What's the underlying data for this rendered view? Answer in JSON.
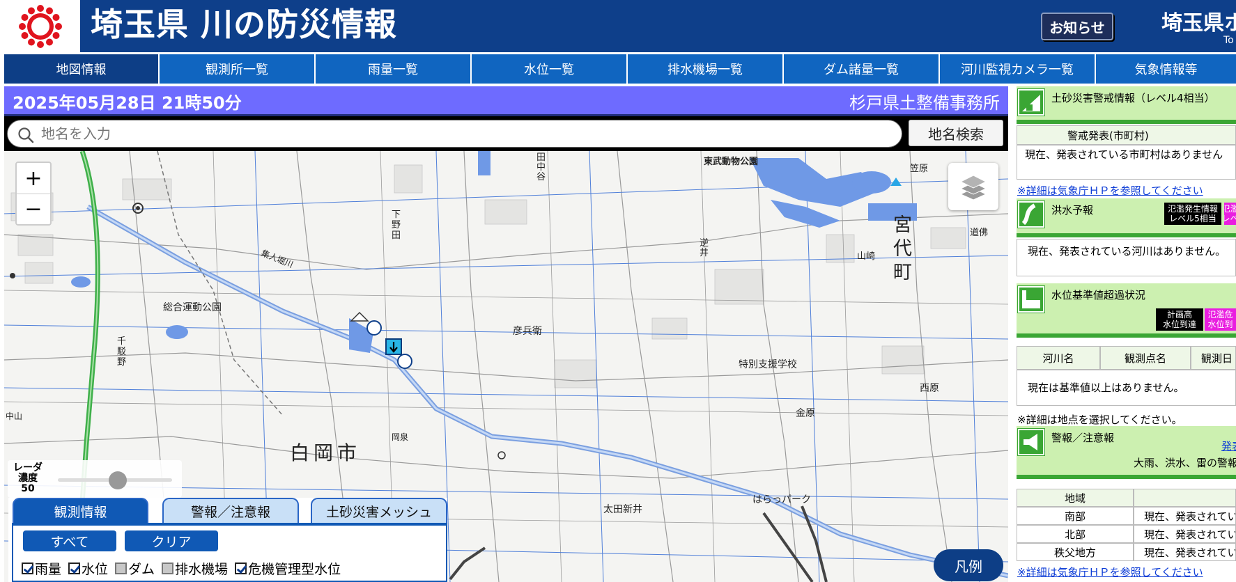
{
  "header": {
    "site_title": "埼玉県 川の防災情報",
    "notice_button": "お知らせ",
    "pref_name": "埼玉県ホ",
    "pref_sub": "To"
  },
  "nav": {
    "items": [
      "地図情報",
      "観測所一覧",
      "雨量一覧",
      "水位一覧",
      "排水機場一覧",
      "ダム諸量一覧",
      "河川監視カメラ一覧",
      "気象情報等"
    ],
    "active": "地図情報"
  },
  "date_bar": {
    "datetime": "2025年05月28日 21時50分",
    "office": "杉戸県土整備事務所"
  },
  "search": {
    "placeholder": "地名を入力",
    "button": "地名検索"
  },
  "map": {
    "zoom_in": "+",
    "zoom_out": "−",
    "labels": {
      "higashibu_park": "東武動物公園",
      "miyashiro": "宮\n代\n町",
      "yamazaki": "山崎",
      "sogo_park": "総合運動公園",
      "okada": "田\n中\n谷",
      "shimonoda": "下\n野\n田",
      "hikobei": "彦兵衛",
      "tokubetsu": "特別支援学校",
      "shiraoka": "白岡市",
      "ohtashinden": "太田新井",
      "harappark": "はらっパーク",
      "kanahara": "金原",
      "nishihara": "西原",
      "sakai": "逆\n井",
      "senkoma": "千\n駁\n野",
      "kasahara": "笠原",
      "dobutsu": "道佛",
      "kurohama": "集人堀川",
      "okuni": "岡泉",
      "nakayama": "中山"
    },
    "radar_label": "レーダ\n濃度\n50",
    "radar_value": 50,
    "legend_button": "凡例"
  },
  "obs_panel": {
    "tabs": [
      "観測情報",
      "警報／注意報",
      "土砂災害メッシュ"
    ],
    "active_tab": "観測情報",
    "buttons": [
      "すべて",
      "クリア"
    ],
    "checkboxes": [
      {
        "label": "雨量",
        "checked": true
      },
      {
        "label": "水位",
        "checked": true
      },
      {
        "label": "ダム",
        "checked": false
      },
      {
        "label": "排水機場",
        "checked": false
      },
      {
        "label": "危機管理型水位",
        "checked": true
      }
    ]
  },
  "right_panel": {
    "landslide": {
      "title": "土砂災害警戒情報（レベル4相当）",
      "col_header": "警戒発表(市町村)",
      "message": "現在、発表されている市町村はありません",
      "link": "※詳細は気象庁ＨＰを参照してください"
    },
    "flood": {
      "title": "洪水予報",
      "tag1": "氾濫発生情報\nレベル5相当",
      "tag2": "氾濫\nレベ",
      "message": "現在、発表されている河川はありません。"
    },
    "water_level": {
      "title": "水位基準値超過状況",
      "tag1": "計画高\n水位到達",
      "tag2": "氾濫危\n水位到",
      "headers": [
        "河川名",
        "観測点名",
        "観測日"
      ],
      "message": "現在は基準値以上はありません。",
      "note": "※詳細は地点を選択してください。"
    },
    "warning": {
      "title": "警報／注意報",
      "link_short": "発表",
      "sub": "大雨、洪水、雷の警報",
      "headers": [
        "地域",
        ""
      ],
      "rows": [
        {
          "area": "南部",
          "status": "現在、発表されてい"
        },
        {
          "area": "北部",
          "status": "現在、発表されてい"
        },
        {
          "area": "秩父地方",
          "status": "現在、発表されてい"
        }
      ],
      "link": "※詳細は気象庁ＨＰを参照してください"
    }
  },
  "colors": {
    "header_bg": "#0e3f8a",
    "nav_bg": "#1065c0",
    "date_bar_bg": "#6e6bff",
    "accent_green": "#3aa634"
  }
}
